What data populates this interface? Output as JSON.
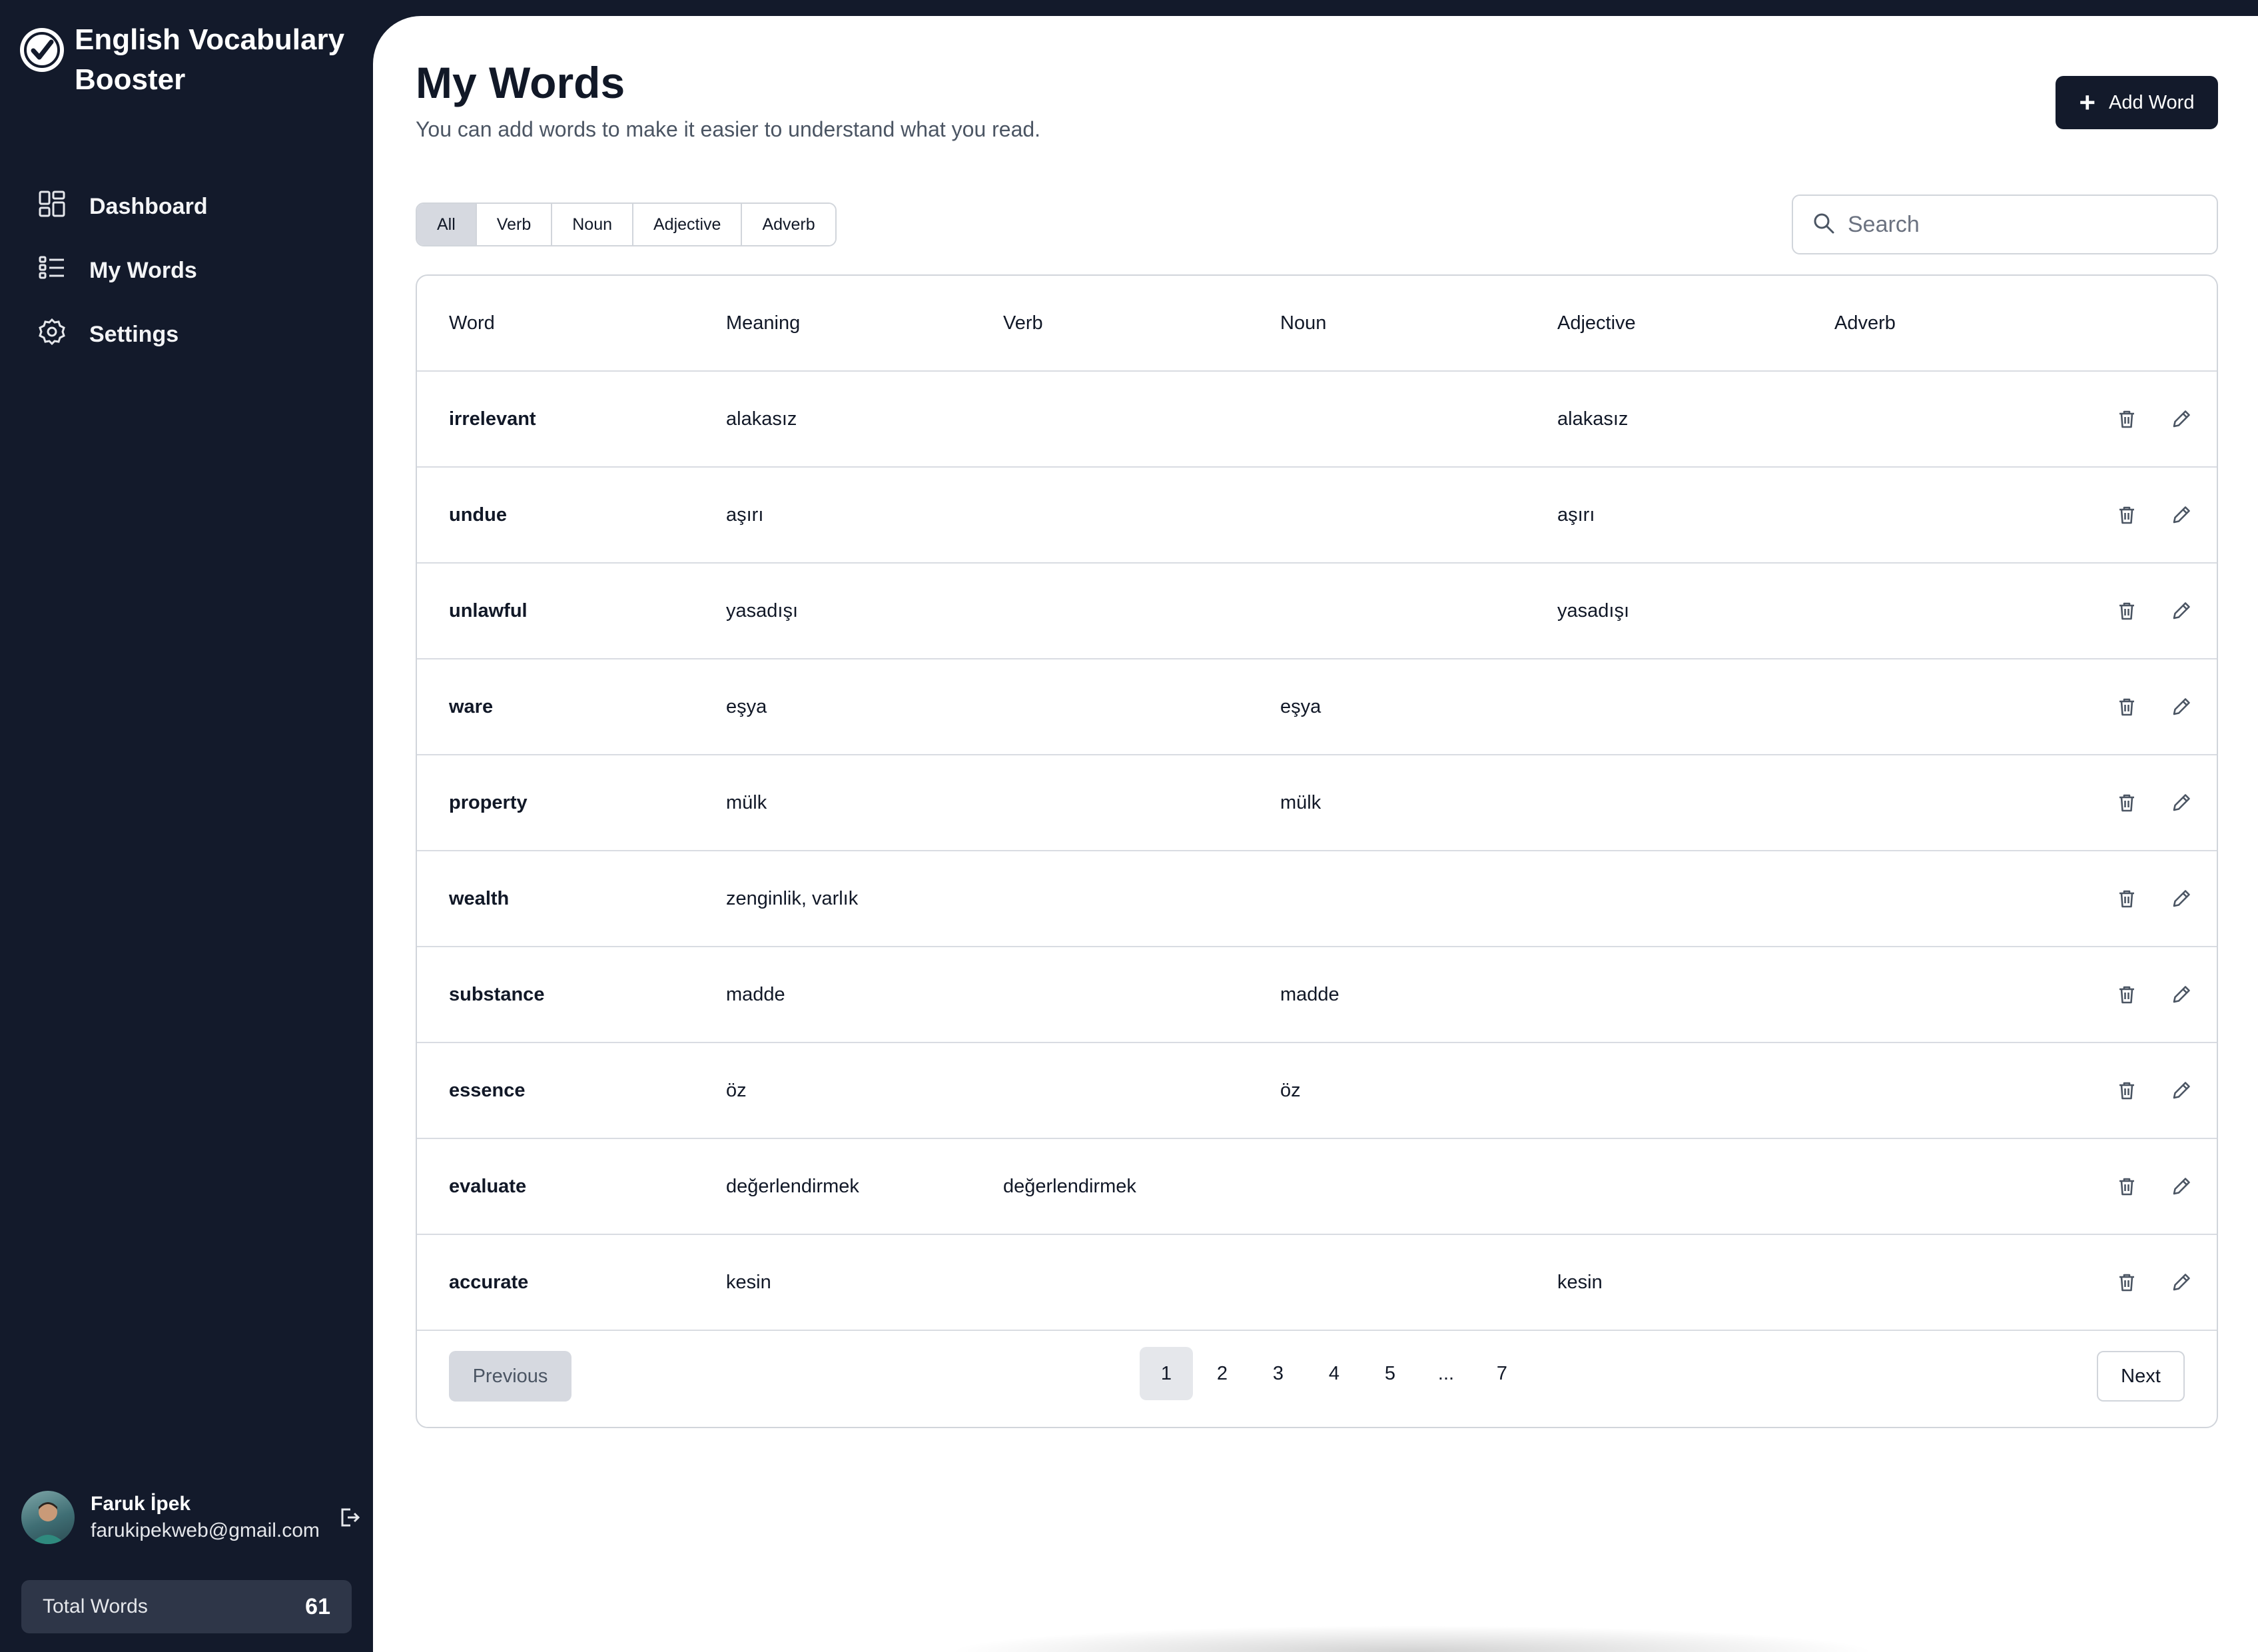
{
  "app": {
    "title": "English Vocabulary Booster"
  },
  "sidebar": {
    "items": [
      {
        "label": "Dashboard",
        "icon": "dashboard-icon"
      },
      {
        "label": "My Words",
        "icon": "list-icon"
      },
      {
        "label": "Settings",
        "icon": "gear-icon"
      }
    ],
    "user": {
      "name": "Faruk İpek",
      "email": "farukipekweb@gmail.com"
    },
    "total": {
      "label": "Total Words",
      "count": "61"
    }
  },
  "header": {
    "title": "My Words",
    "subtitle": "You can add words to make it easier to understand what you read.",
    "add_label": "Add Word"
  },
  "filters": [
    "All",
    "Verb",
    "Noun",
    "Adjective",
    "Adverb"
  ],
  "search": {
    "placeholder": "Search",
    "value": ""
  },
  "table": {
    "columns": [
      "Word",
      "Meaning",
      "Verb",
      "Noun",
      "Adjective",
      "Adverb"
    ],
    "rows": [
      [
        "irrelevant",
        "alakasız",
        "",
        "",
        "alakasız",
        ""
      ],
      [
        "undue",
        "aşırı",
        "",
        "",
        "aşırı",
        ""
      ],
      [
        "unlawful",
        "yasadışı",
        "",
        "",
        "yasadışı",
        ""
      ],
      [
        "ware",
        "eşya",
        "",
        "eşya",
        "",
        ""
      ],
      [
        "property",
        "mülk",
        "",
        "mülk",
        "",
        ""
      ],
      [
        "wealth",
        "zenginlik, varlık",
        "",
        "",
        "",
        ""
      ],
      [
        "substance",
        "madde",
        "",
        "madde",
        "",
        ""
      ],
      [
        "essence",
        "öz",
        "",
        "öz",
        "",
        ""
      ],
      [
        "evaluate",
        "değerlendirmek",
        "değerlendirmek",
        "",
        "",
        ""
      ],
      [
        "accurate",
        "kesin",
        "",
        "",
        "kesin",
        ""
      ]
    ]
  },
  "pagination": {
    "previous_label": "Previous",
    "next_label": "Next",
    "pages": [
      "1",
      "2",
      "3",
      "4",
      "5",
      "...",
      "7"
    ],
    "current": "1"
  },
  "colors": {
    "sidebar_bg": "#131a2b",
    "accent": "#131a2b",
    "border": "#d1d5db"
  }
}
